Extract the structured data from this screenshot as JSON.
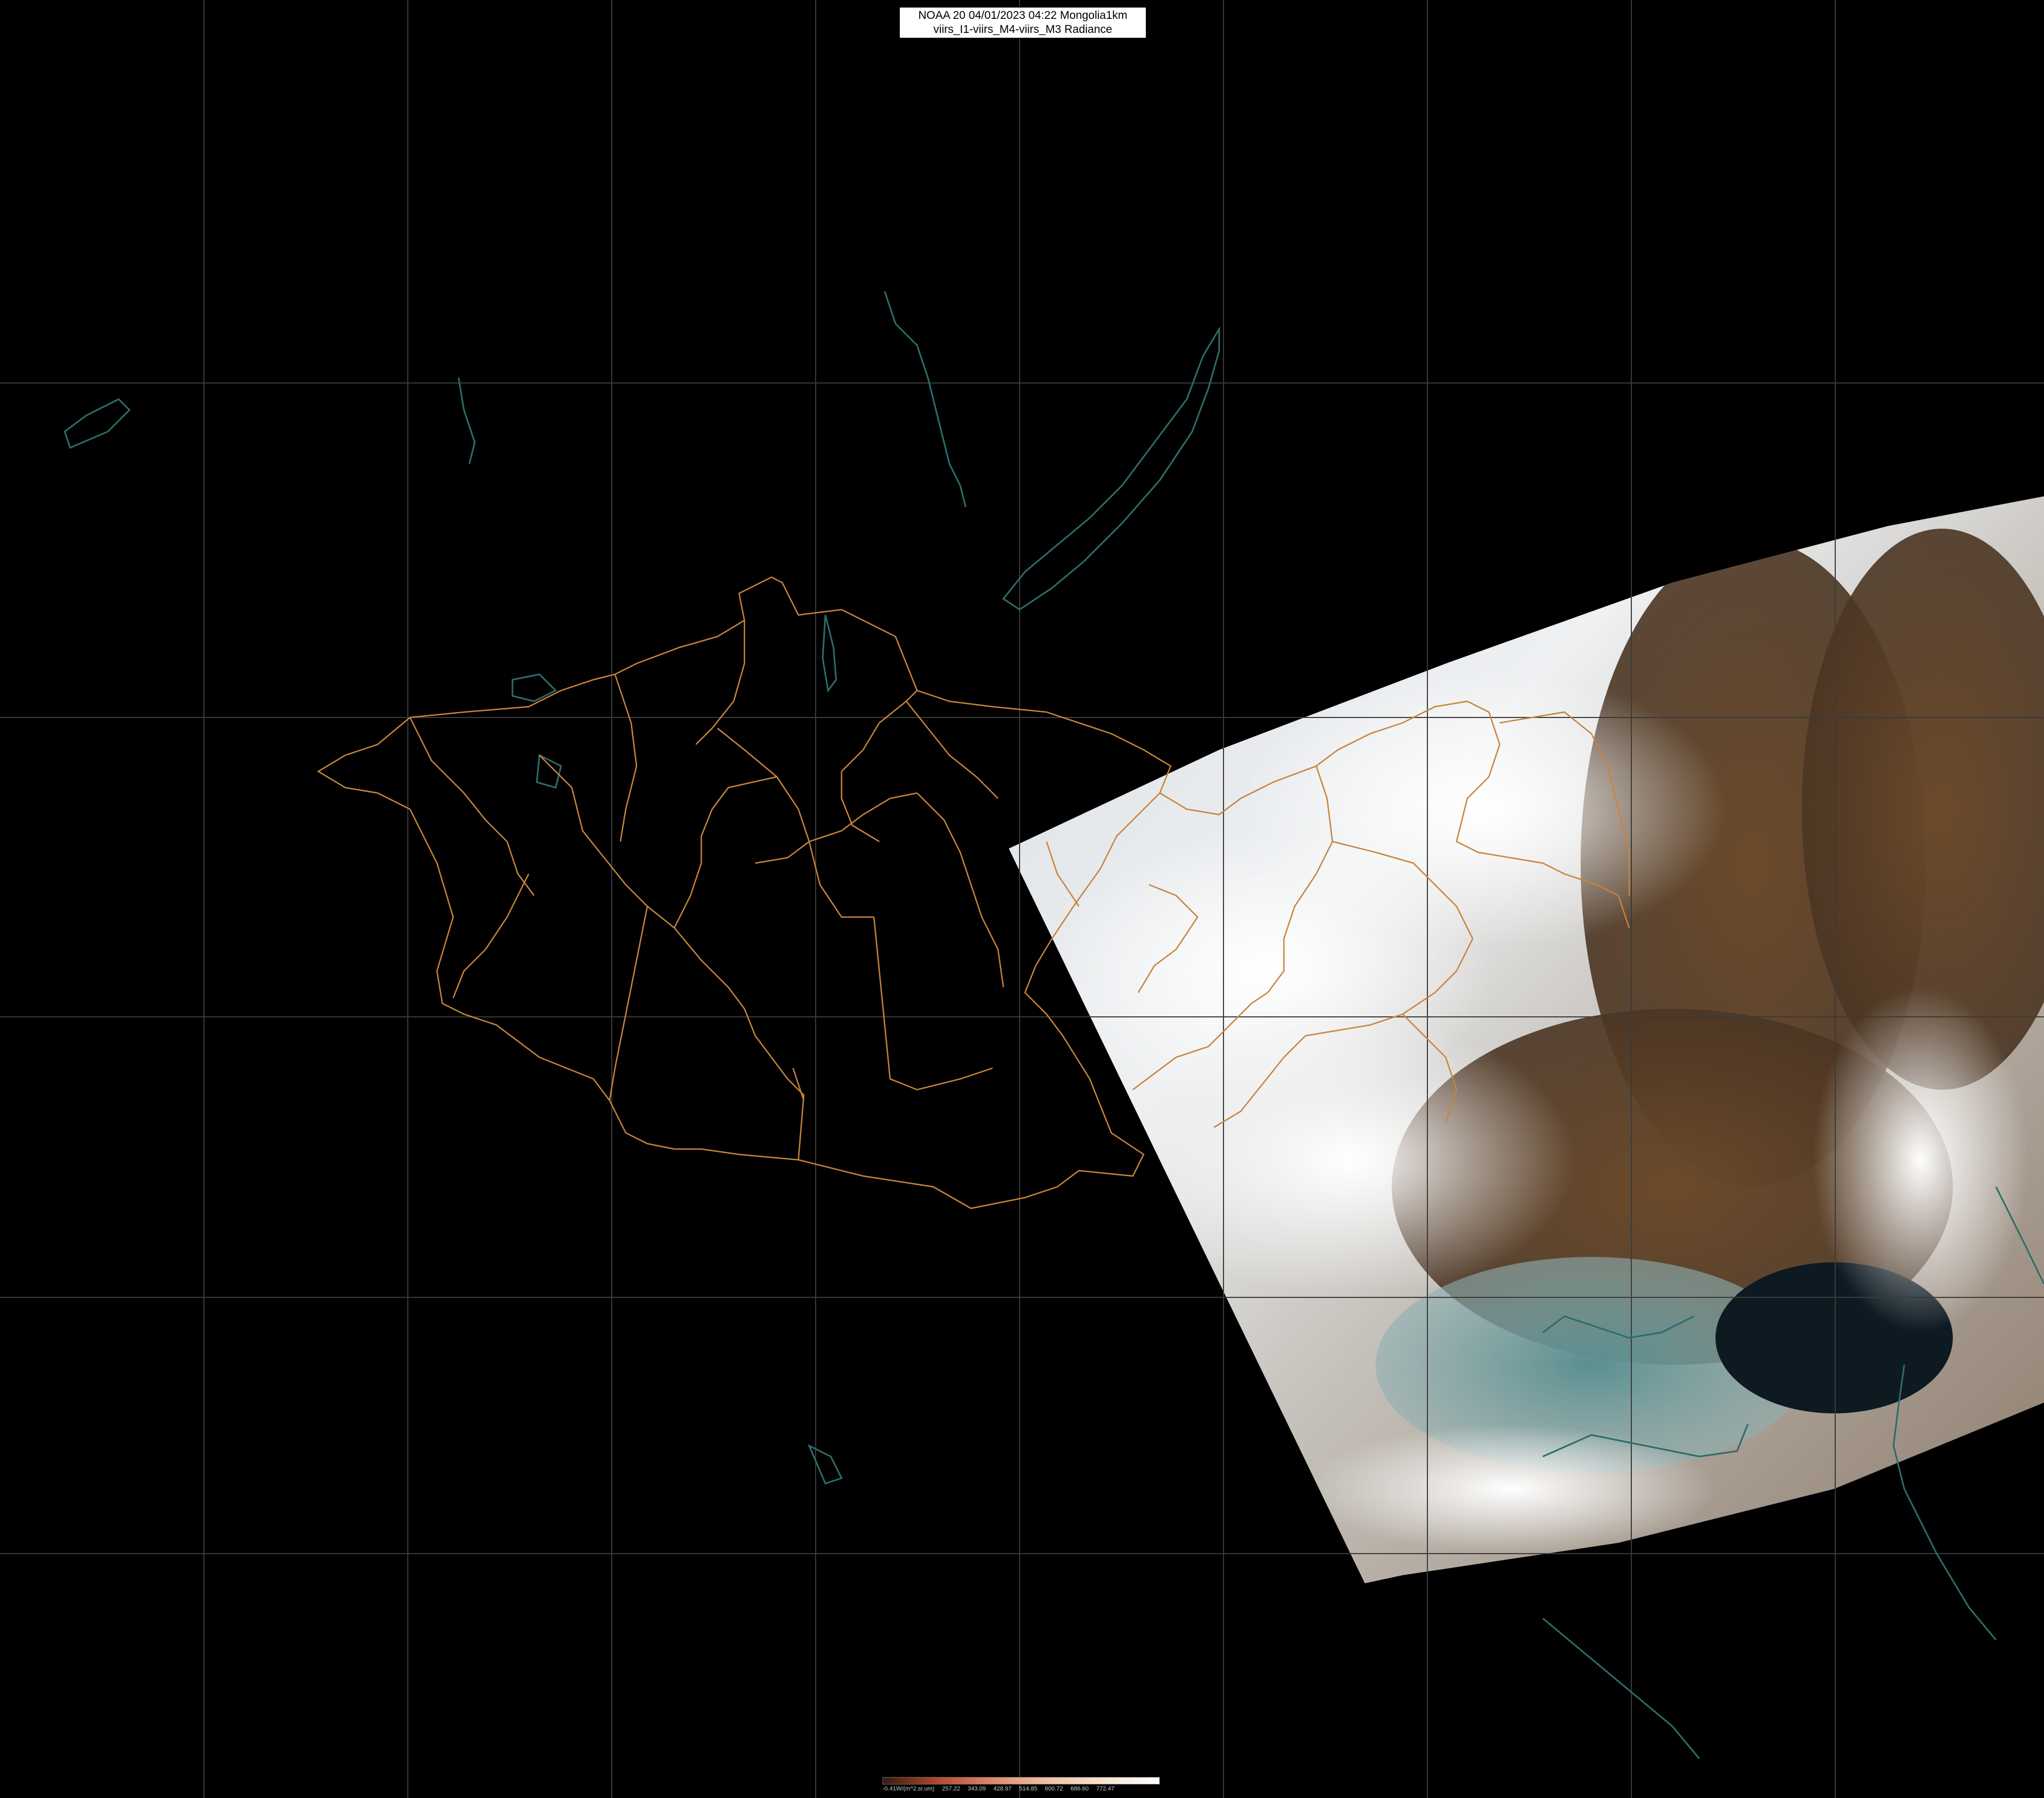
{
  "header": {
    "line1": "NOAA 20 04/01/2023 04:22 Mongolia1km",
    "line2": "viirs_I1-viirs_M4-viirs_M3 Radiance"
  },
  "colorbar": {
    "labels": [
      "-0.41W/(m^2.sr.um)",
      "257.22",
      "343.09",
      "428.97",
      "514.85",
      "600.72",
      "686.60",
      "772.47"
    ],
    "gradient": [
      "#3a1a10",
      "#b5482c",
      "#e08a6a",
      "#f1c2a8",
      "#f7e3cf",
      "#ffffff"
    ]
  },
  "colors": {
    "background": "#000000",
    "gridline": "#3a3a3a",
    "province_border": "#c8843c",
    "coastline": "#2f6b6b"
  }
}
